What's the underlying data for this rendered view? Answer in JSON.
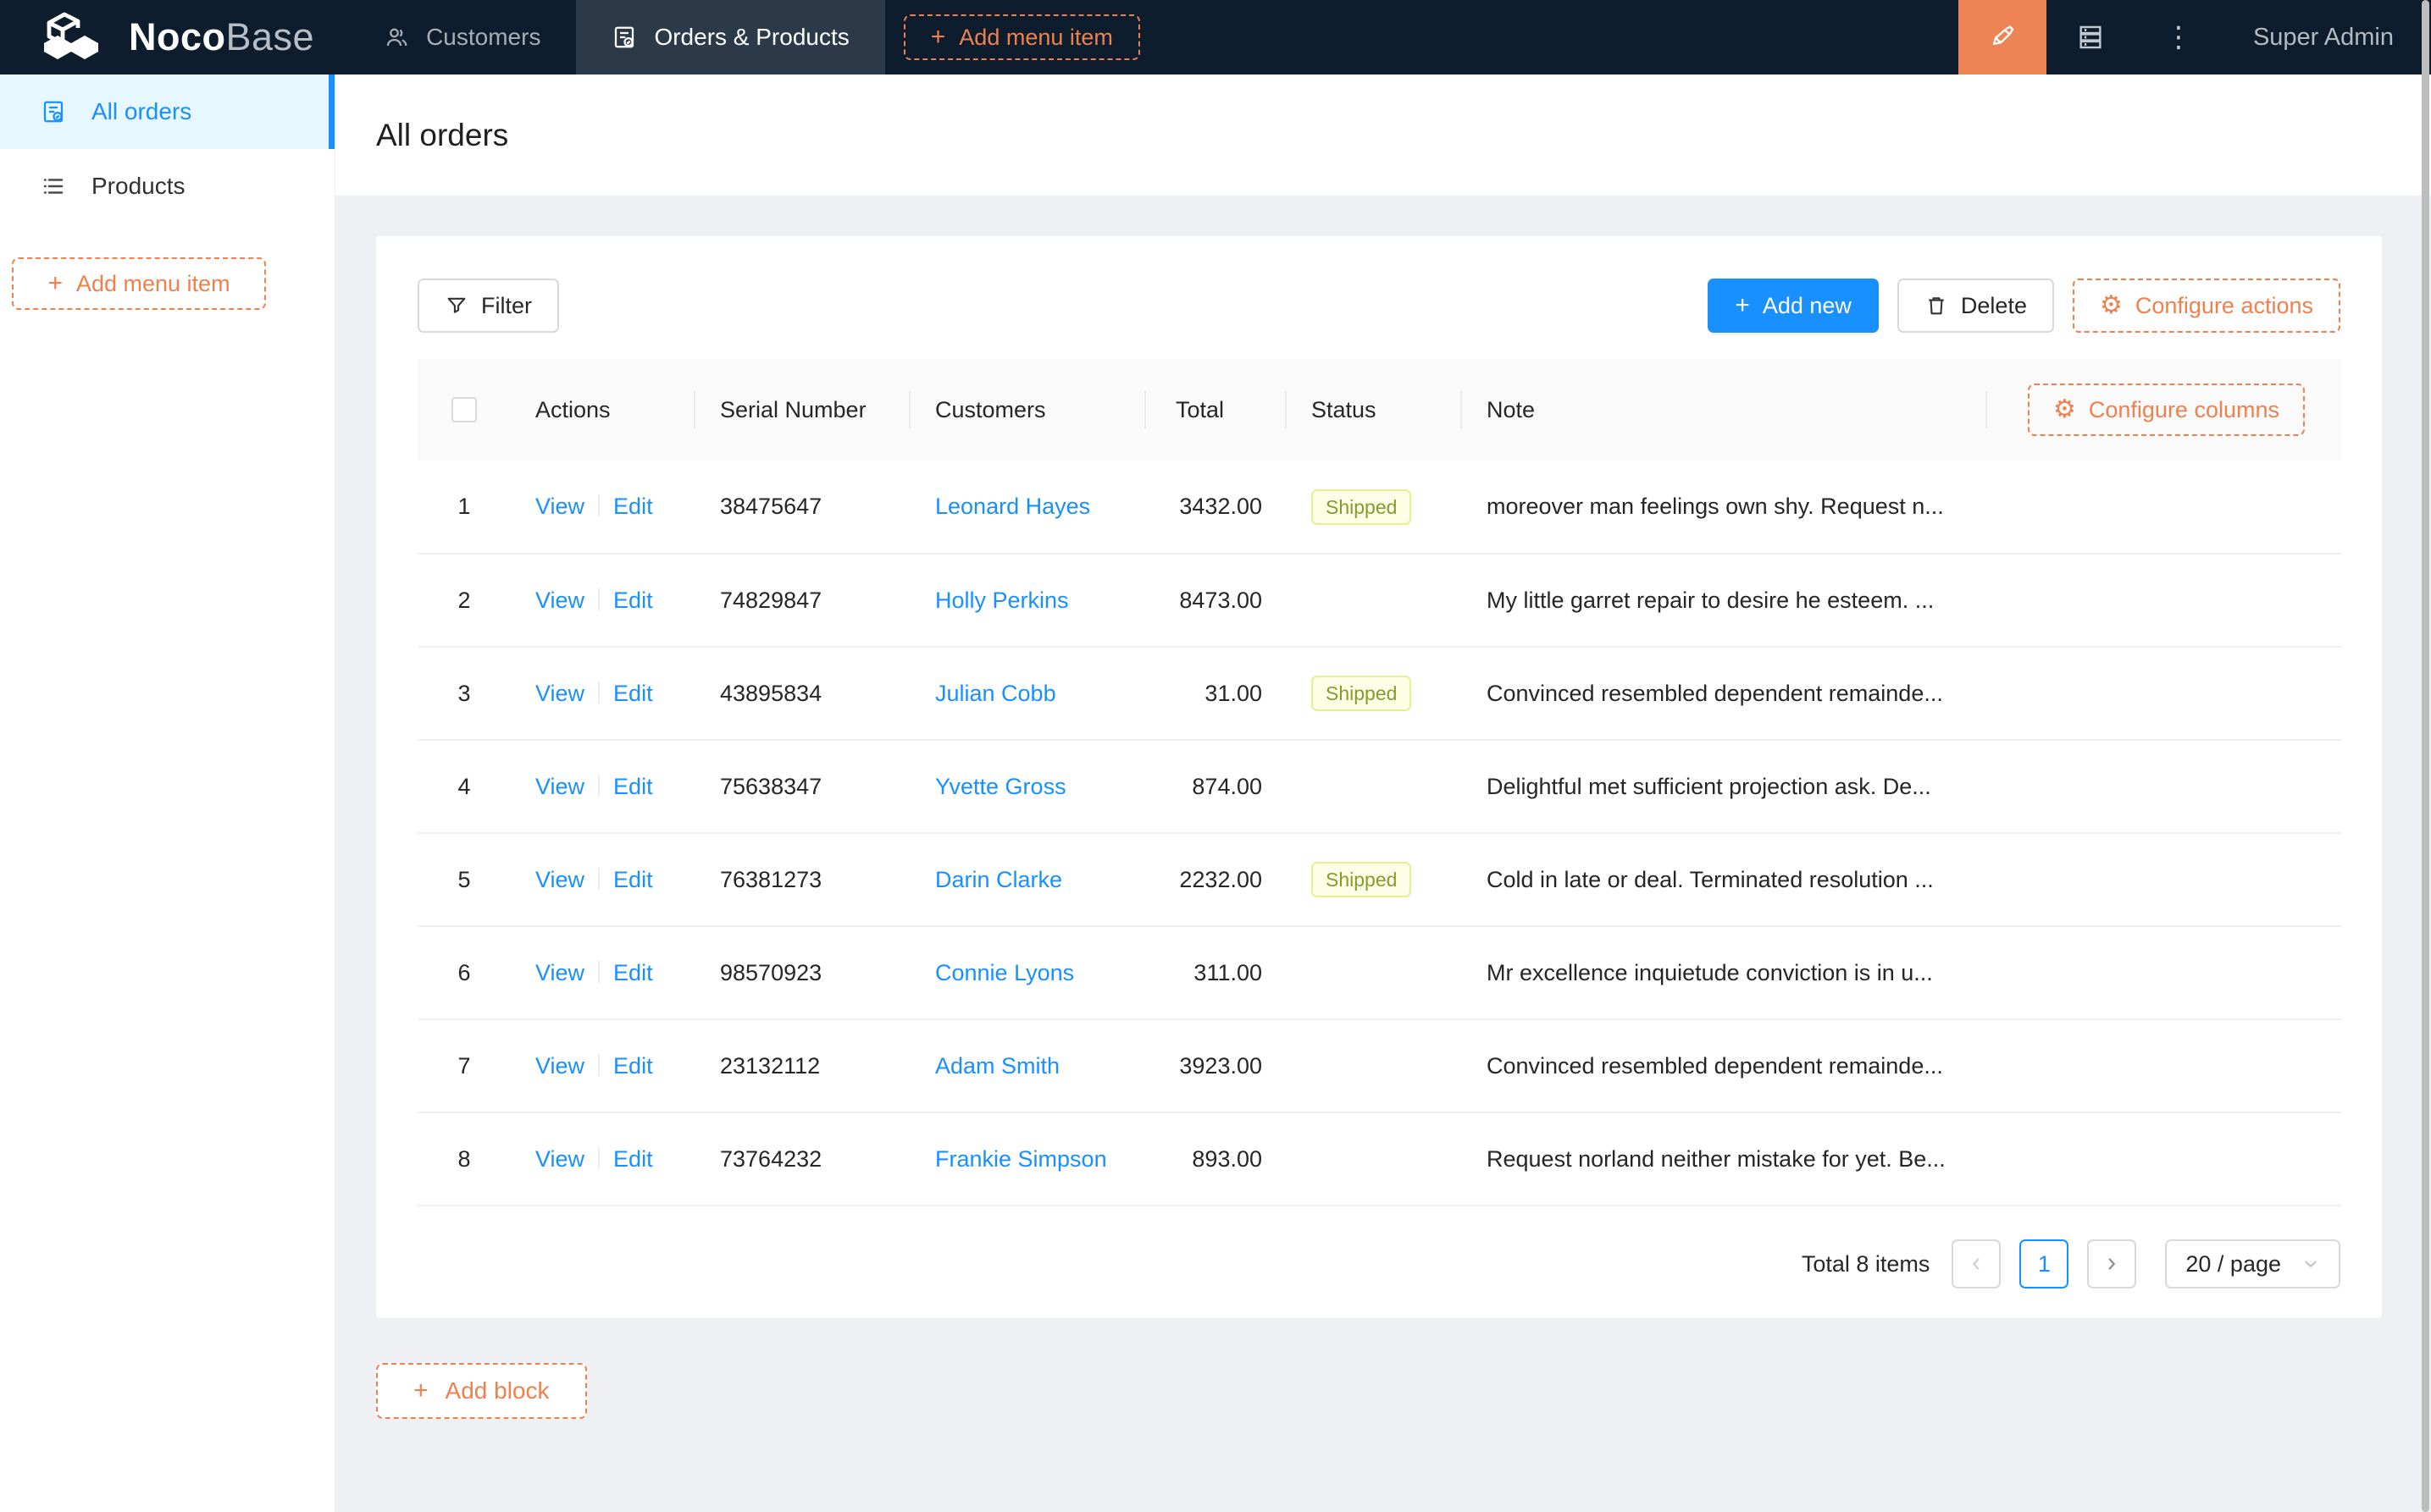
{
  "navbar": {
    "logo": {
      "noco": "Noco",
      "base": "Base"
    },
    "menu_items": [
      {
        "label": "Customers",
        "icon": "users-icon",
        "active": false
      },
      {
        "label": "Orders & Products",
        "icon": "file-check-icon",
        "active": true
      }
    ],
    "add_menu_item_label": "Add menu item",
    "user_label": "Super Admin",
    "icon_buttons": [
      "ui-editor-highlighter-icon",
      "database-icon",
      "kebab-menu-icon"
    ]
  },
  "sidebar": {
    "items": [
      {
        "label": "All orders",
        "icon": "file-check-icon",
        "active": true
      },
      {
        "label": "Products",
        "icon": "list-icon",
        "active": false
      }
    ],
    "add_menu_item_label": "Add menu item"
  },
  "page": {
    "title": "All orders"
  },
  "toolbar": {
    "filter_label": "Filter",
    "add_new_label": "Add new",
    "delete_label": "Delete",
    "configure_actions_label": "Configure actions"
  },
  "table": {
    "configure_columns_label": "Configure columns",
    "columns": [
      "Actions",
      "Serial Number",
      "Customers",
      "Total",
      "Status",
      "Note"
    ],
    "action_labels": {
      "view": "View",
      "edit": "Edit"
    },
    "rows": [
      {
        "index": "1",
        "serial": "38475647",
        "customer": "Leonard Hayes",
        "total": "3432.00",
        "status": "Shipped",
        "note": "moreover man feelings own shy. Request n..."
      },
      {
        "index": "2",
        "serial": "74829847",
        "customer": "Holly Perkins",
        "total": "8473.00",
        "status": "",
        "note": "My little garret repair to desire he esteem. ..."
      },
      {
        "index": "3",
        "serial": "43895834",
        "customer": "Julian Cobb",
        "total": "31.00",
        "status": "Shipped",
        "note": "Convinced resembled dependent remainde..."
      },
      {
        "index": "4",
        "serial": "75638347",
        "customer": "Yvette Gross",
        "total": "874.00",
        "status": "",
        "note": "Delightful met sufficient projection ask. De..."
      },
      {
        "index": "5",
        "serial": "76381273",
        "customer": "Darin Clarke",
        "total": "2232.00",
        "status": "Shipped",
        "note": "Cold in late or deal. Terminated resolution ..."
      },
      {
        "index": "6",
        "serial": "98570923",
        "customer": "Connie Lyons",
        "total": "311.00",
        "status": "",
        "note": "Mr excellence inquietude conviction is in u..."
      },
      {
        "index": "7",
        "serial": "23132112",
        "customer": "Adam Smith",
        "total": "3923.00",
        "status": "",
        "note": "Convinced resembled dependent remainde..."
      },
      {
        "index": "8",
        "serial": "73764232",
        "customer": "Frankie Simpson",
        "total": "893.00",
        "status": "",
        "note": "Request norland neither mistake for yet. Be..."
      }
    ]
  },
  "pagination": {
    "total_text": "Total 8 items",
    "current_page": "1",
    "page_size_label": "20 / page"
  },
  "footer": {
    "add_block_label": "Add block"
  },
  "colors": {
    "accent_orange": "#ef814f",
    "primary_blue": "#1890ff",
    "navbar_bg": "#0d1d2e",
    "active_tab_bg": "#2b3948",
    "sidebar_active_bg": "#e6f7ff",
    "status_tag_bg": "#fcffe6",
    "status_tag_border": "#e6f093",
    "status_tag_text": "#879b2d",
    "table_header_bg": "#fafafa",
    "page_bg": "#eef0f3"
  }
}
